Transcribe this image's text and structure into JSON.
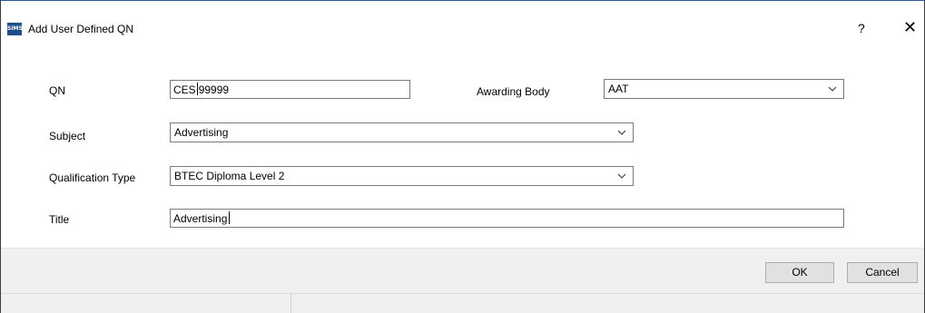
{
  "window": {
    "logo_text": "SIMS",
    "title": "Add User Defined QN",
    "help_label": "?",
    "close_label": "✕"
  },
  "form": {
    "qn": {
      "label": "QN",
      "prefix": "CES",
      "value": "99999"
    },
    "awarding_body": {
      "label": "Awarding Body",
      "value": "AAT"
    },
    "subject": {
      "label": "Subject",
      "value": "Advertising"
    },
    "qualification_type": {
      "label": "Qualification Type",
      "value": "BTEC Diploma Level 2"
    },
    "title": {
      "label": "Title",
      "value": "Advertising"
    }
  },
  "buttons": {
    "ok": "OK",
    "cancel": "Cancel"
  },
  "icons": {
    "dropdown": "chevron-down-icon",
    "help": "help-icon",
    "close": "close-icon",
    "logo": "sims-logo-icon"
  },
  "colors": {
    "logo_bg": "#1f4e8c",
    "footer_bg": "#f0f0f0",
    "button_bg": "#e1e1e1"
  }
}
